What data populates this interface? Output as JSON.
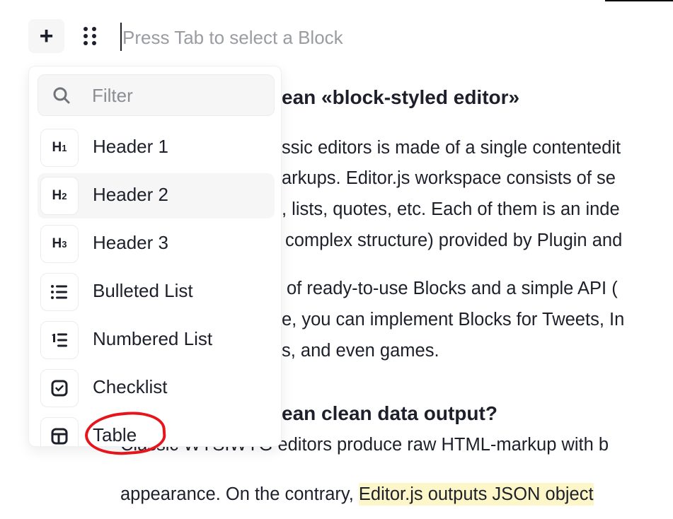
{
  "toolbar": {
    "add_icon": "plus-icon",
    "drag_icon": "drag-dots-icon",
    "placeholder": "Press Tab to select a Block"
  },
  "content": {
    "heading1": "ean «block-styled editor»",
    "para1": [
      "ssic editors is made of a single contentedit",
      "arkups. Editor.js workspace consists of se",
      ", lists, quotes, etc. Each of them is an inde",
      "complex structure) provided by Plugin and"
    ],
    "para2": [
      "of ready-to-use Blocks and a simple API (",
      "e, you can implement Blocks for Tweets, In",
      "s, and even games."
    ],
    "heading2": "ean clean data output?",
    "para3_line1": "Classic WYSIWYG editors produce raw HTML-markup with b",
    "para3_line2_plain": "appearance. On the contrary, ",
    "para3_line2_highlight": "Editor.js outputs JSON object",
    "highlight_color": "#fdf6c8"
  },
  "popup": {
    "filter_placeholder": "Filter",
    "items": [
      {
        "label": "Header 1",
        "icon": "H1"
      },
      {
        "label": "Header 2",
        "icon": "H2",
        "hovered": true
      },
      {
        "label": "Header 3",
        "icon": "H3"
      },
      {
        "label": "Bulleted List",
        "icon": "bulleted-list-icon"
      },
      {
        "label": "Numbered List",
        "icon": "numbered-list-icon"
      },
      {
        "label": "Checklist",
        "icon": "checklist-icon"
      },
      {
        "label": "Table",
        "icon": "table-icon"
      }
    ]
  },
  "annotation_color": "#e8141c"
}
